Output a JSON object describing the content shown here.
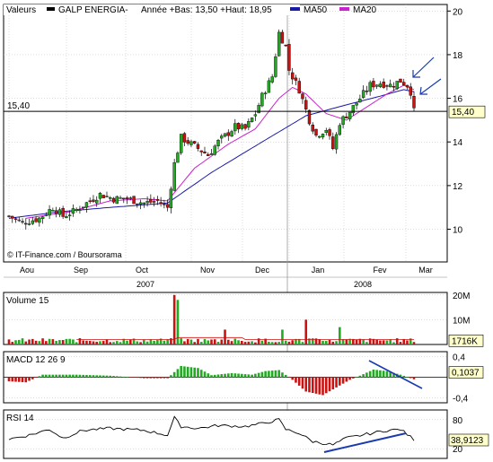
{
  "chart_data": [
    {
      "type": "candlestick",
      "header": {
        "prefix": "Valeurs",
        "name": "GALP ENERGIA-",
        "range_text": "Année +Bas: 13,50 +Haut: 18,95",
        "ma50_label": "MA50",
        "ma20_label": "MA20"
      },
      "yticks": [
        "20",
        "18",
        "16",
        "14",
        "12",
        "10"
      ],
      "ylim": [
        8.5,
        20.3
      ],
      "ref_line": {
        "value": 15.4,
        "label": "15,40"
      },
      "last_value": "15,40",
      "source": "© IT-Finance.com / Boursorama",
      "months": [
        "Aou",
        "Sep",
        "Oct",
        "Nov",
        "Dec",
        "Jan",
        "Fev",
        "Mar"
      ],
      "years": [
        "2007",
        "2008"
      ],
      "colors": {
        "up": "#22aa22",
        "down": "#cc1111",
        "ma50": "#1a1aa8",
        "ma20": "#cc22cc"
      },
      "anchors": [
        [
          0,
          10.6
        ],
        [
          4,
          10.3
        ],
        [
          9,
          10.5
        ],
        [
          13,
          11.0
        ],
        [
          16,
          10.6
        ],
        [
          19,
          10.8
        ],
        [
          23,
          11.2
        ],
        [
          27,
          11.6
        ],
        [
          31,
          11.4
        ],
        [
          35,
          11.4
        ],
        [
          40,
          11.2
        ],
        [
          44,
          11.3
        ],
        [
          47,
          11.0
        ],
        [
          49,
          13.0
        ],
        [
          51,
          14.2
        ],
        [
          55,
          13.8
        ],
        [
          59,
          13.4
        ],
        [
          62,
          14.0
        ],
        [
          67,
          14.7
        ],
        [
          70,
          14.6
        ],
        [
          73,
          15.3
        ],
        [
          75,
          16.1
        ],
        [
          78,
          17.0
        ],
        [
          80,
          19.0
        ],
        [
          82,
          18.4
        ],
        [
          83,
          17.3
        ],
        [
          86,
          16.4
        ],
        [
          89,
          15.0
        ],
        [
          91,
          14.3
        ],
        [
          94,
          14.6
        ],
        [
          96,
          13.7
        ],
        [
          98,
          14.9
        ],
        [
          101,
          15.4
        ],
        [
          104,
          16.0
        ],
        [
          107,
          16.6
        ],
        [
          110,
          16.7
        ],
        [
          113,
          16.6
        ],
        [
          116,
          16.8
        ],
        [
          118,
          16.6
        ],
        [
          119,
          16.3
        ],
        [
          120,
          15.4
        ]
      ],
      "ma20": [
        [
          5,
          10.5
        ],
        [
          18,
          10.8
        ],
        [
          30,
          11.3
        ],
        [
          40,
          11.4
        ],
        [
          47,
          11.3
        ],
        [
          55,
          12.8
        ],
        [
          65,
          13.9
        ],
        [
          73,
          14.6
        ],
        [
          80,
          16.0
        ],
        [
          84,
          16.5
        ],
        [
          88,
          16.2
        ],
        [
          94,
          15.3
        ],
        [
          100,
          15.0
        ],
        [
          106,
          15.6
        ],
        [
          112,
          16.2
        ],
        [
          117,
          16.6
        ],
        [
          120,
          16.4
        ]
      ],
      "ma50": [
        [
          0,
          10.5
        ],
        [
          15,
          10.8
        ],
        [
          30,
          11.0
        ],
        [
          47,
          11.2
        ],
        [
          60,
          12.6
        ],
        [
          75,
          14.0
        ],
        [
          88,
          15.2
        ],
        [
          100,
          15.7
        ],
        [
          110,
          16.1
        ],
        [
          117,
          16.4
        ],
        [
          120,
          16.3
        ]
      ]
    },
    {
      "type": "bar",
      "title": "Volume 15",
      "yticks": [
        "20M",
        "10M"
      ],
      "ylim": [
        0,
        21
      ],
      "last_value": "1716K",
      "volume_spikes": [
        [
          49,
          20
        ],
        [
          50,
          18
        ],
        [
          64,
          6
        ],
        [
          81,
          6
        ],
        [
          88,
          10
        ],
        [
          98,
          7
        ]
      ],
      "base_volume": 1.7,
      "avg_line": 2.0
    },
    {
      "type": "bar",
      "title": "MACD 12 26 9",
      "yticks": [
        "0,4",
        "-0,4"
      ],
      "ylim": [
        -0.5,
        0.5
      ],
      "last_value": "0,1037"
    },
    {
      "type": "line",
      "title": "RSI 14",
      "yticks": [
        "80",
        "20"
      ],
      "ylim": [
        0,
        100
      ],
      "last_value": "38,9123",
      "rsi_anchors": [
        [
          0,
          40
        ],
        [
          6,
          48
        ],
        [
          12,
          60
        ],
        [
          16,
          42
        ],
        [
          22,
          58
        ],
        [
          30,
          62
        ],
        [
          40,
          58
        ],
        [
          47,
          48
        ],
        [
          49,
          84
        ],
        [
          51,
          66
        ],
        [
          56,
          62
        ],
        [
          62,
          68
        ],
        [
          70,
          66
        ],
        [
          75,
          72
        ],
        [
          80,
          80
        ],
        [
          82,
          60
        ],
        [
          86,
          52
        ],
        [
          90,
          35
        ],
        [
          96,
          28
        ],
        [
          100,
          42
        ],
        [
          106,
          50
        ],
        [
          112,
          58
        ],
        [
          116,
          60
        ],
        [
          120,
          39
        ]
      ]
    }
  ]
}
